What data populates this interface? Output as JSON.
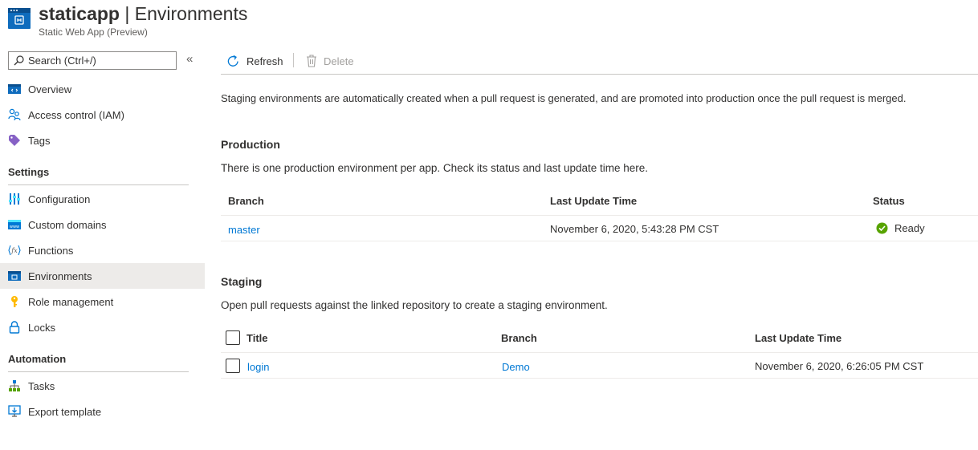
{
  "header": {
    "app_name": "staticapp",
    "separator": " | ",
    "page_title": "Environments",
    "subtitle": "Static Web App (Preview)"
  },
  "sidebar": {
    "search_placeholder": "Search (Ctrl+/)",
    "collapse_glyph": "«",
    "items_top": [
      {
        "label": "Overview",
        "icon": "overview-icon"
      },
      {
        "label": "Access control (IAM)",
        "icon": "people-icon"
      },
      {
        "label": "Tags",
        "icon": "tag-icon"
      }
    ],
    "settings_heading": "Settings",
    "items_settings": [
      {
        "label": "Configuration",
        "icon": "sliders-icon"
      },
      {
        "label": "Custom domains",
        "icon": "www-icon"
      },
      {
        "label": "Functions",
        "icon": "function-icon"
      },
      {
        "label": "Environments",
        "icon": "environments-icon",
        "active": true
      },
      {
        "label": "Role management",
        "icon": "key-icon"
      },
      {
        "label": "Locks",
        "icon": "lock-icon"
      }
    ],
    "automation_heading": "Automation",
    "items_automation": [
      {
        "label": "Tasks",
        "icon": "tasks-icon"
      },
      {
        "label": "Export template",
        "icon": "export-template-icon"
      }
    ]
  },
  "toolbar": {
    "refresh_label": "Refresh",
    "delete_label": "Delete"
  },
  "description": "Staging environments are automatically created when a pull request is generated, and are promoted into production once the pull request is merged.",
  "production": {
    "title": "Production",
    "description": "There is one production environment per app. Check its status and last update time here.",
    "columns": {
      "branch": "Branch",
      "last_update": "Last Update Time",
      "status": "Status"
    },
    "rows": [
      {
        "branch": "master",
        "last_update": "November 6, 2020, 5:43:28 PM CST",
        "status": "Ready"
      }
    ]
  },
  "staging": {
    "title": "Staging",
    "description": "Open pull requests against the linked repository to create a staging environment.",
    "columns": {
      "title": "Title",
      "branch": "Branch",
      "last_update": "Last Update Time"
    },
    "rows": [
      {
        "title": "login",
        "branch": "Demo",
        "last_update": "November 6, 2020, 6:26:05 PM CST"
      }
    ]
  },
  "colors": {
    "accent": "#0078d4",
    "ready": "#57a300",
    "active_bg": "#edebe9"
  }
}
